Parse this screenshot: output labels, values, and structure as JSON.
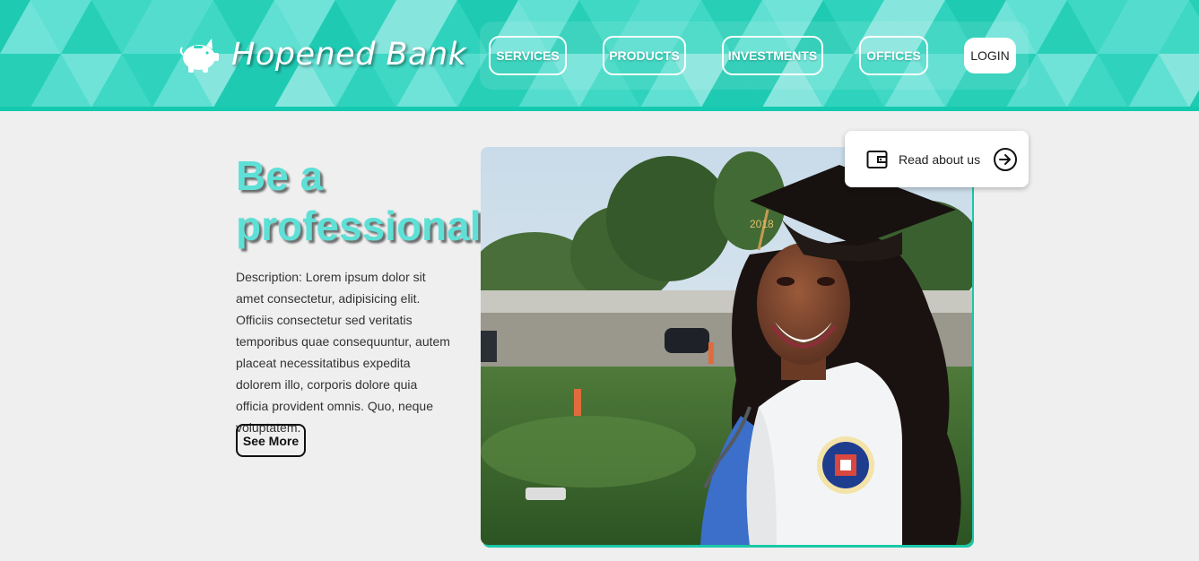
{
  "brand": {
    "name": "Hopened Bank",
    "logo_icon": "piggy-bank-icon"
  },
  "nav": {
    "items": [
      {
        "label": "SERVICES"
      },
      {
        "label": "PRODUCTS"
      },
      {
        "label": "INVESTMENTS"
      },
      {
        "label": "OFFICES"
      }
    ],
    "login_label": "LOGIN"
  },
  "hero": {
    "title_line1": "Be a",
    "title_line2": "professional",
    "description": "Description: Lorem ipsum dolor sit amet consectetur, adipisicing elit. Officiis consectetur sed veritatis temporibus quae consequuntur, autem placeat necessitatibus expedita dolorem illo, corporis dolore quia officia provident omnis. Quo, neque voluptatem.",
    "see_more_label": "See More"
  },
  "photo": {
    "cap_year": "2018"
  },
  "read_card": {
    "label": "Read about us",
    "icon": "wallet-icon",
    "arrow_icon": "arrow-right-circle-icon"
  },
  "colors": {
    "accent": "#2fd6c0",
    "title": "#5ee0d6",
    "background": "#efefef"
  }
}
